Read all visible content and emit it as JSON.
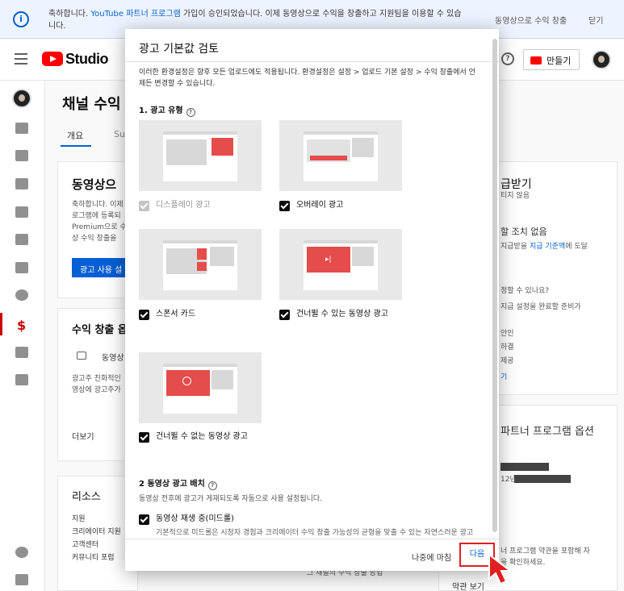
{
  "banner": {
    "text_prefix": "축하합니다. ",
    "text_highlight": "YouTube 파트너 프로그램",
    "text_suffix": " 가입이 승인되었습니다. 이제 동영상으로 수익을 창출하고 지원팀을 이용할 수 있습니다.",
    "link_monetize": "동영상으로 수익 창출",
    "link_close": "닫기"
  },
  "header": {
    "logo_text": "Studio",
    "create_label": "만들기"
  },
  "page": {
    "title": "채널 수익",
    "tabs": [
      "개요",
      "Su"
    ]
  },
  "bg_cards": {
    "card1_title": "동영상으",
    "card1_lines": [
      "축하합니다. 이제",
      "로그램에 등록되",
      "Premium으로 수",
      "상 수익 창출을"
    ],
    "card1_button": "광고 사용 설",
    "card2_title": "수익 창출 옵",
    "card2_item": "동영상",
    "card2_lines": [
      "광고주 친화적인",
      "영상에 광고주가"
    ],
    "card2_more": "더보기",
    "card3_title": "리소스",
    "card3_items": [
      "지원",
      "크리에이터 지원",
      "고객센터",
      "커뮤니티 포럼"
    ],
    "card3_bottom": "그 채널의 수익 창출 방법",
    "right_title": "급받기",
    "right_sub": "티지 않음",
    "right_head2": "할 조치 없음",
    "right_l1": "지급받을 ",
    "right_link": "지급 기준액",
    "right_l1b": "에 도달",
    "right_q": "정할 수 있나요?",
    "right_l2": "지급 설정을 완료할 준비가",
    "right_items": [
      "안인",
      "하결",
      "제공"
    ],
    "right_more": "기",
    "right_partner": "파트너 프로그램 옵션",
    "right_date": "12년",
    "right_l3": "너 프로그램 약관을 포함해 자",
    "right_l4": "을 확인하세요.",
    "right_terms": "약관 보기"
  },
  "dialog": {
    "title": "광고 기본값 검토",
    "intro": "이러한 환경설정은 향후 모든 업로드에도 적용됩니다. 환경설정은 설정 > 업로드 기본 설정 > 수익 창출에서 언제든 변경할 수 있습니다.",
    "section1": "1. 광고 유형",
    "ad_types": [
      {
        "label": "디스플레이 광고",
        "checked": true,
        "disabled": true
      },
      {
        "label": "오버레이 광고",
        "checked": true,
        "disabled": false
      },
      {
        "label": "스폰서 카드",
        "checked": true,
        "disabled": false
      },
      {
        "label": "건너뛸 수 있는 동영상 광고",
        "checked": true,
        "disabled": false
      },
      {
        "label": "건너뛸 수 없는 동영상 광고",
        "checked": true,
        "disabled": false
      }
    ],
    "section2": "2 동영상 광고 배치",
    "section2_desc": "동영상 전후에 광고가 게재되도록 자동으로 사용 설정됩니다.",
    "midroll_label": "동영상 재생 중(미드롤)",
    "midroll_desc": "기본적으로 미드롤은 시청자 경험과 크리에이터 수익 창출 가능성의 균형을 맞출 수 있는 자연스러운 광고",
    "btn_later": "나중에 마침",
    "btn_next": "다음"
  },
  "colors": {
    "accent": "#065fd4",
    "brand_red": "#ff0000",
    "ad_red": "#e54c4c",
    "highlight_border": "#e02020"
  }
}
